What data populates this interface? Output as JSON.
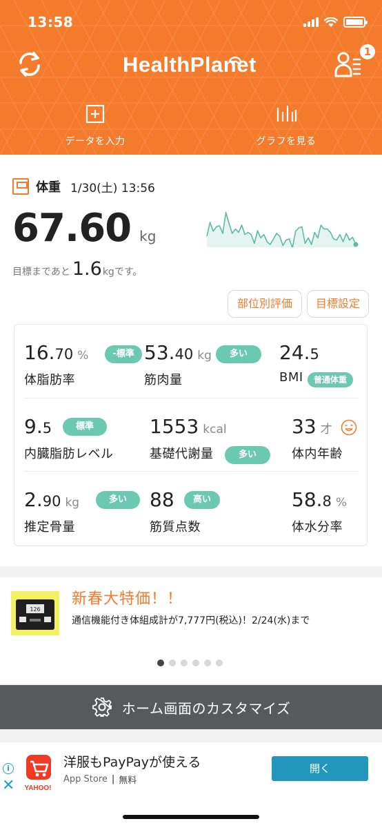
{
  "status_bar": {
    "time": "13:58"
  },
  "header": {
    "logo": "HealthPlanet",
    "notification_count": "1",
    "actions": [
      {
        "label": "データを入力",
        "icon": "plus-box-icon"
      },
      {
        "label": "グラフを見る",
        "icon": "bar-chart-icon"
      }
    ]
  },
  "weight": {
    "title": "体重",
    "datetime": "1/30(土) 13:56",
    "value": "67.60",
    "unit": "kg",
    "goal_prefix": "目標まであと",
    "goal_value": "1.6",
    "goal_suffix": "kgです。",
    "trend": [
      65,
      40,
      56,
      48,
      46,
      60,
      22,
      42,
      60,
      52,
      58,
      45,
      62,
      58,
      62,
      78,
      55,
      68,
      62,
      75,
      80,
      70,
      60,
      65,
      82,
      72,
      70,
      86,
      56,
      50,
      48,
      78,
      68,
      80,
      58,
      68,
      45,
      52,
      52,
      58,
      70,
      72,
      62,
      75,
      60,
      72,
      67,
      80
    ],
    "buttons": {
      "part_eval": "部位別評価",
      "goal_setting": "目標設定"
    }
  },
  "metrics": {
    "body_fat": {
      "int": "16.",
      "dec": "70",
      "unit": "%",
      "tag": "-標準",
      "label": "体脂肪率"
    },
    "muscle": {
      "int": "53.",
      "dec": "40",
      "unit": "kg",
      "tag": "多い",
      "label": "筋肉量"
    },
    "bmi": {
      "int": "24.",
      "dec": "5",
      "tag": "普通体重",
      "label": "BMI"
    },
    "visceral": {
      "int": "9.",
      "dec": "5",
      "tag": "標準",
      "label": "内臓脂肪レベル"
    },
    "bmr": {
      "int": "1553",
      "unit": "kcal",
      "tag": "多い",
      "label": "基礎代謝量"
    },
    "body_age": {
      "int": "33",
      "unit": "才",
      "label": "体内年齢"
    },
    "bone": {
      "int": "2.",
      "dec": "90",
      "unit": "kg",
      "tag": "多い",
      "label": "推定骨量"
    },
    "muscle_score": {
      "int": "88",
      "tag": "高い",
      "label": "筋質点数"
    },
    "water": {
      "int": "58.",
      "dec": "8",
      "unit": "%",
      "label": "体水分率"
    }
  },
  "promo": {
    "title": "新春大特価！！",
    "text": "通信機能付き体組成計が7,777円(税込)！2/24(水)まで",
    "device_readout": "126",
    "slides": 6,
    "active_slide": 1
  },
  "customize": {
    "label": "ホーム画面のカスタマイズ"
  },
  "ad": {
    "title": "洋服もPayPayが使える",
    "store": "App Store",
    "price": "無料",
    "cta": "開く",
    "brand": "YAHOO!"
  },
  "colors": {
    "brand": "#f47a2c",
    "tag": "#6cc9b1",
    "ad_button": "#2396bb",
    "customize_bar": "#575a5c"
  }
}
